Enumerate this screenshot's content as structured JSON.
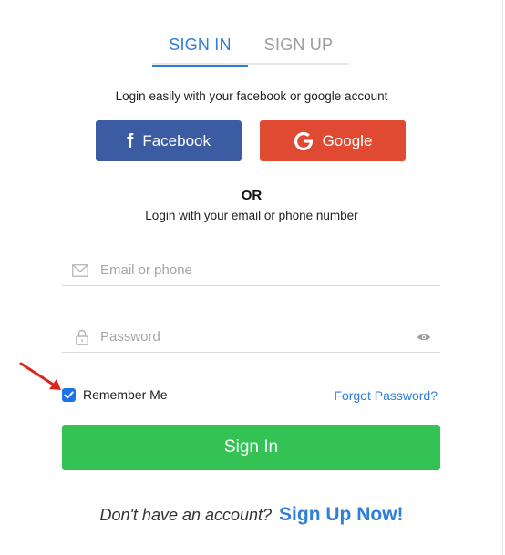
{
  "tabs": {
    "signin": "SIGN IN",
    "signup": "SIGN UP"
  },
  "social_hint": "Login easily with your facebook or google account",
  "facebook_label": "Facebook",
  "facebook_icon": "facebook-f-icon",
  "google_label": "Google",
  "google_icon": "google-g-icon",
  "or_label": "OR",
  "email_hint": "Login with your email or phone number",
  "email_field": {
    "placeholder": "Email or phone",
    "value": "",
    "icon": "envelope-icon"
  },
  "password_field": {
    "placeholder": "Password",
    "value": "",
    "icon": "lock-icon",
    "toggle_icon": "eye-icon"
  },
  "remember_me": {
    "label": "Remember Me",
    "checked": true
  },
  "forgot_password": "Forgot Password?",
  "signin_button": "Sign In",
  "no_account_text": "Don't have an account?",
  "signup_now": "Sign Up Now!",
  "colors": {
    "accent": "#2f7ed8",
    "facebook": "#3b5ba3",
    "google": "#e04a32",
    "signin": "#34c254",
    "arrow": "#e0241b"
  }
}
